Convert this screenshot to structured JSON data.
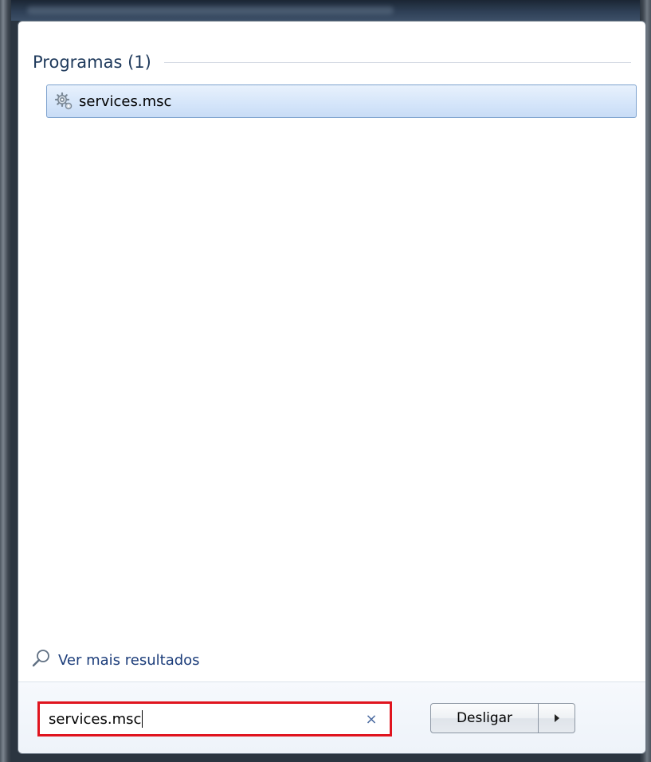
{
  "results": {
    "section_title": "Programas (1)",
    "items": [
      {
        "label": "services.msc",
        "icon": "services-gear-icon"
      }
    ]
  },
  "more_results": {
    "label": "Ver mais resultados",
    "icon": "magnifier-icon"
  },
  "search": {
    "value": "services.msc",
    "clear_symbol": "×",
    "highlight_color": "#e0141e"
  },
  "shutdown": {
    "label": "Desligar",
    "arrow_icon": "arrow-right-icon"
  }
}
